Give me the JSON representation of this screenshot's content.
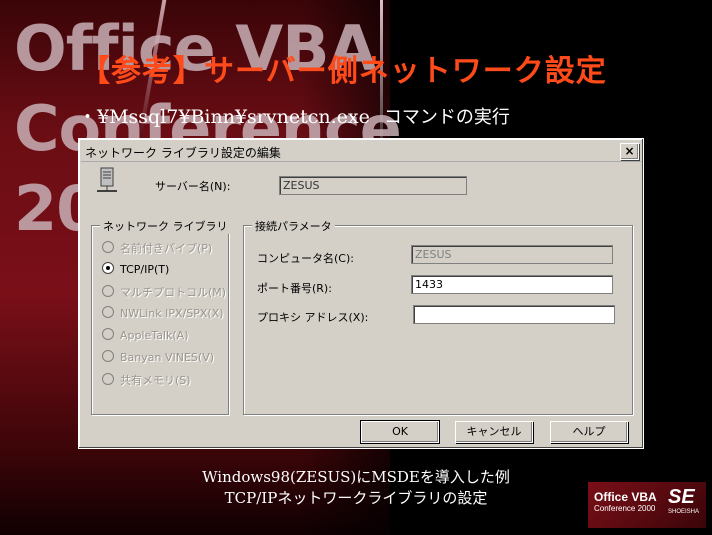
{
  "slide": {
    "watermark": [
      "Office VBA",
      "Conference",
      "2000"
    ],
    "title": "【参考】サーバー側ネットワーク設定",
    "bullet_cmd": "・¥Mssql7¥Binn¥srvnetcn.exe",
    "bullet_action": "コマンドの実行",
    "caption_line1": "Windows98(ZESUS)にMSDEを導入した例",
    "caption_line2": "TCP/IPネットワークライブラリの設定"
  },
  "dialog": {
    "title": "ネットワーク ライブラリ設定の編集",
    "close_label": "×",
    "server_label": "サーバー名(N):",
    "server_value": "ZESUS",
    "library_group_label": "ネットワーク ライブラリ",
    "libraries": [
      {
        "label": "名前付きパイプ(P)",
        "selected": false,
        "enabled": false
      },
      {
        "label": "TCP/IP(T)",
        "selected": true,
        "enabled": true
      },
      {
        "label": "マルチプロトコル(M)",
        "selected": false,
        "enabled": false
      },
      {
        "label": "NWLink IPX/SPX(X)",
        "selected": false,
        "enabled": false
      },
      {
        "label": "AppleTalk(A)",
        "selected": false,
        "enabled": false
      },
      {
        "label": "Banyan VINES(V)",
        "selected": false,
        "enabled": false
      },
      {
        "label": "共有メモリ(S)",
        "selected": false,
        "enabled": false
      }
    ],
    "params_group_label": "接続パラメータ",
    "computer_label": "コンピュータ名(C):",
    "computer_value": "ZESUS",
    "port_label": "ポート番号(R):",
    "port_value": "1433",
    "proxy_label": "プロキシ アドレス(X):",
    "proxy_value": "",
    "ok_label": "OK",
    "cancel_label": "キャンセル",
    "help_label": "ヘルプ"
  },
  "logo": {
    "main": "Office VBA",
    "sub": "Conference 2000",
    "brand": "SE",
    "publisher": "SHOEISHA"
  }
}
